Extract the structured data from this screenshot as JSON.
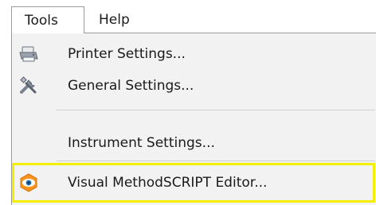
{
  "menubar": {
    "tools_label": "Tools",
    "help_label": "Help"
  },
  "dropdown": {
    "items": [
      {
        "label": "Printer Settings...",
        "icon": "printer-icon"
      },
      {
        "label": "General Settings...",
        "icon": "tools-icon"
      },
      {
        "label": "Instrument Settings...",
        "icon": ""
      },
      {
        "label": "Visual MethodSCRIPT Editor...",
        "icon": "visual-methodscript-icon"
      }
    ],
    "highlight_color": "#f2ef00",
    "background_color": "#f2f2f2"
  }
}
